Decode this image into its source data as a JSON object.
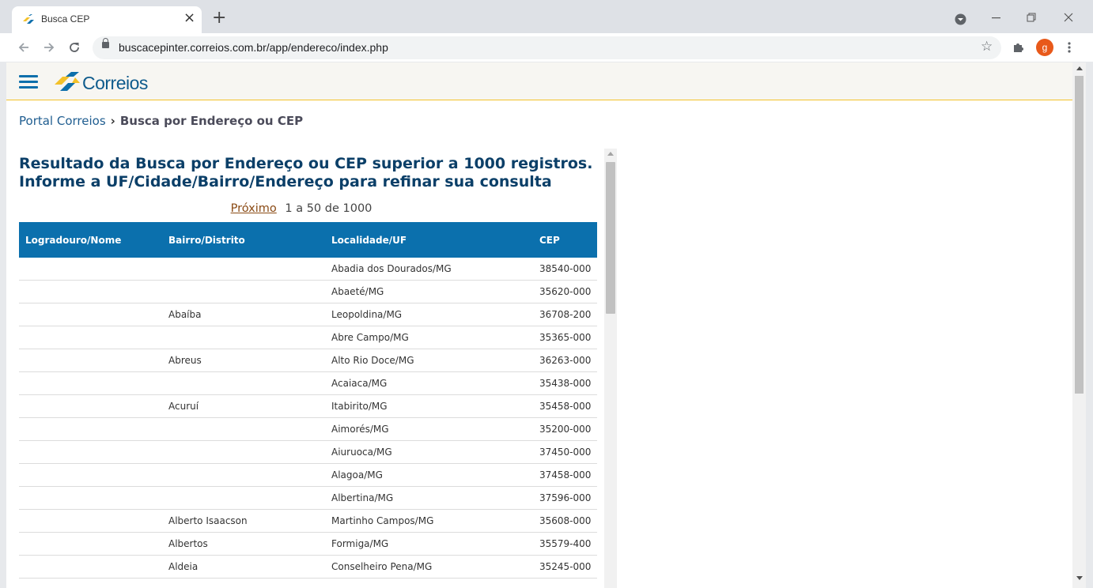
{
  "browser": {
    "tab_title": "Busca CEP",
    "tab_close": "×",
    "new_tab": "+",
    "url": "buscacepinter.correios.com.br/app/endereco/index.php",
    "profile_initial": "g"
  },
  "header": {
    "logo_text": "Correios"
  },
  "breadcrumb": {
    "home": "Portal Correios",
    "separator": "›",
    "current": "Busca por Endereço ou CEP"
  },
  "results": {
    "title_line1": "Resultado da Busca por Endereço ou CEP superior a 1000 registros.",
    "title_line2": "Informe a UF/Cidade/Bairro/Endereço para refinar sua consulta",
    "next_label": "Próximo",
    "range_label": "1 a 50 de 1000",
    "columns": [
      "Logradouro/Nome",
      "Bairro/Distrito",
      "Localidade/UF",
      "CEP"
    ],
    "rows": [
      {
        "logradouro": "",
        "bairro": "",
        "localidade": "Abadia dos Dourados/MG",
        "cep": "38540-000"
      },
      {
        "logradouro": "",
        "bairro": "",
        "localidade": "Abaeté/MG",
        "cep": "35620-000"
      },
      {
        "logradouro": "",
        "bairro": "Abaíba",
        "localidade": "Leopoldina/MG",
        "cep": "36708-200"
      },
      {
        "logradouro": "",
        "bairro": "",
        "localidade": "Abre Campo/MG",
        "cep": "35365-000"
      },
      {
        "logradouro": "",
        "bairro": "Abreus",
        "localidade": "Alto Rio Doce/MG",
        "cep": "36263-000"
      },
      {
        "logradouro": "",
        "bairro": "",
        "localidade": "Acaiaca/MG",
        "cep": "35438-000"
      },
      {
        "logradouro": "",
        "bairro": "Acuruí",
        "localidade": "Itabirito/MG",
        "cep": "35458-000"
      },
      {
        "logradouro": "",
        "bairro": "",
        "localidade": "Aimorés/MG",
        "cep": "35200-000"
      },
      {
        "logradouro": "",
        "bairro": "",
        "localidade": "Aiuruoca/MG",
        "cep": "37450-000"
      },
      {
        "logradouro": "",
        "bairro": "",
        "localidade": "Alagoa/MG",
        "cep": "37458-000"
      },
      {
        "logradouro": "",
        "bairro": "",
        "localidade": "Albertina/MG",
        "cep": "37596-000"
      },
      {
        "logradouro": "",
        "bairro": "Alberto Isaacson",
        "localidade": "Martinho Campos/MG",
        "cep": "35608-000"
      },
      {
        "logradouro": "",
        "bairro": "Albertos",
        "localidade": "Formiga/MG",
        "cep": "35579-400"
      },
      {
        "logradouro": "",
        "bairro": "Aldeia",
        "localidade": "Conselheiro Pena/MG",
        "cep": "35245-000"
      }
    ]
  },
  "icons": {
    "back": "back-arrow-icon",
    "forward": "forward-arrow-icon",
    "reload": "reload-icon",
    "lock": "lock-icon",
    "bookmark": "star-icon",
    "extensions": "puzzle-icon",
    "menu": "kebab-menu-icon",
    "site_menu": "hamburger-icon"
  },
  "colors": {
    "brand_blue": "#0b70ad",
    "brand_yellow": "#f3c12a",
    "title_blue": "#0b3f68",
    "link_brown": "#8a4a14"
  }
}
